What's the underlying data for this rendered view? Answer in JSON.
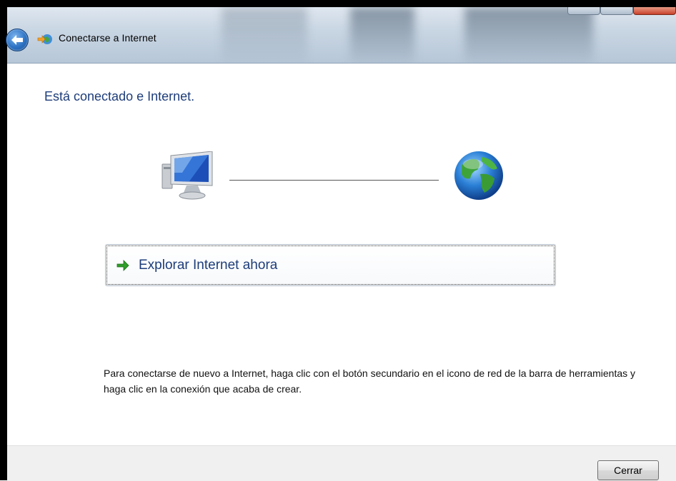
{
  "window": {
    "title": "Conectarse a Internet",
    "accent": "#1e3d7a"
  },
  "content": {
    "heading": "Está conectado e Internet.",
    "browse_label": "Explorar Internet ahora",
    "info_text": "Para conectarse de nuevo a Internet, haga clic con el botón secundario en el icono de red de la barra de herramientas y haga clic en la conexión que acaba de crear."
  },
  "footer": {
    "close_label": "Cerrar"
  },
  "icons": {
    "back": "back-arrow-icon",
    "title": "network-connection-icon",
    "computer": "computer-icon",
    "globe": "globe-icon",
    "browse": "green-arrow-icon"
  }
}
